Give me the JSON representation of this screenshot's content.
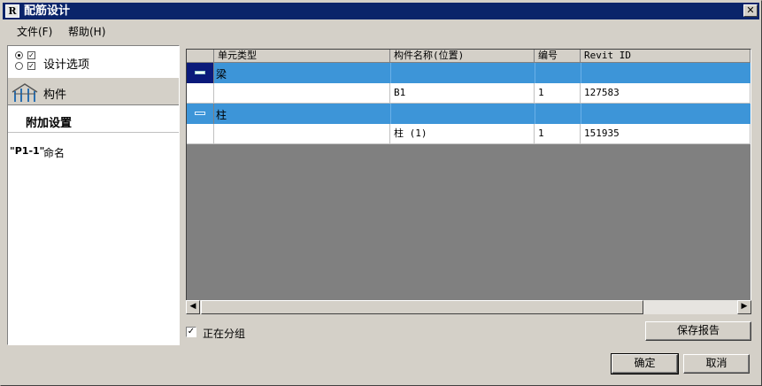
{
  "window": {
    "title": "配筋设计",
    "app_icon_letter": "R",
    "close_glyph": "✕"
  },
  "menu": [
    {
      "label": "文件(F)"
    },
    {
      "label": "帮助(H)"
    }
  ],
  "left_panel": {
    "design_options_label": "设计选项",
    "component_label": "构件",
    "extra_settings_label": "附加设置",
    "naming_code": "\"P1-1\"",
    "naming_label": "命名"
  },
  "grid": {
    "columns": [
      "单元类型",
      "构件名称(位置)",
      "编号",
      "Revit ID"
    ],
    "groups": [
      {
        "label": "梁",
        "rows": [
          {
            "unit_type": "",
            "name": "B1",
            "number": "1",
            "revit_id": "127583"
          }
        ]
      },
      {
        "label": "柱",
        "rows": [
          {
            "unit_type": "",
            "name": "柱 (1)",
            "number": "1",
            "revit_id": "151935"
          }
        ]
      }
    ]
  },
  "grouping": {
    "label": "正在分组",
    "checked": true,
    "check_glyph": "✓"
  },
  "buttons": {
    "save_report": "保存报告",
    "ok": "确定",
    "cancel": "取消"
  },
  "colors": {
    "title_bar": "#0a246a",
    "group_row": "#3d95d8",
    "selected_toggle": "#0a1a7a",
    "grid_empty": "#808080"
  }
}
